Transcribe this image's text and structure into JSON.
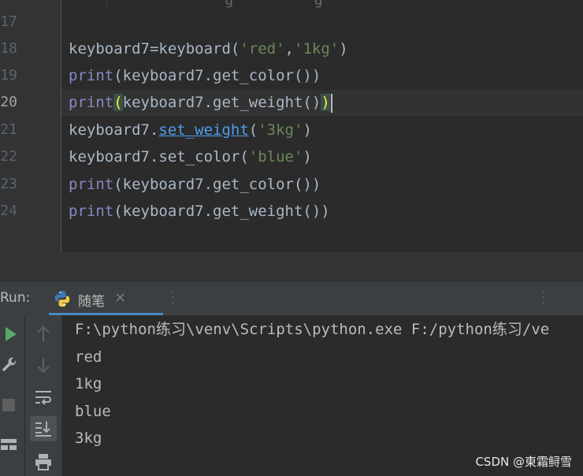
{
  "editor": {
    "top_cut_text": "    g         g      ",
    "line_numbers": [
      "17",
      "18",
      "19",
      "20",
      "21",
      "22",
      "23",
      "24"
    ],
    "current_line": "20",
    "lines": [
      {
        "num": "18",
        "tokens": [
          "keyboard7=keyboard(",
          "'red'",
          ",",
          "'1kg'",
          ")"
        ]
      },
      {
        "num": "19",
        "tokens": [
          "print",
          "(keyboard7.get_color())"
        ]
      },
      {
        "num": "20",
        "tokens": [
          "print",
          "(",
          "keyboard7.get_weight()",
          ")"
        ]
      },
      {
        "num": "21",
        "tokens": [
          "keyboard7.",
          "set_weight",
          "(",
          "'3kg'",
          ")"
        ]
      },
      {
        "num": "22",
        "tokens": [
          "keyboard7.set_color(",
          "'blue'",
          ")"
        ]
      },
      {
        "num": "23",
        "tokens": [
          "print",
          "(keyboard7.get_color())"
        ]
      },
      {
        "num": "24",
        "tokens": [
          "print",
          "(keyboard7.get_weight())"
        ]
      }
    ]
  },
  "run_panel": {
    "label": "Run:",
    "tab": {
      "label": "随笔",
      "close": "×",
      "icon": "python-icon"
    },
    "output": [
      "F:\\python练习\\venv\\Scripts\\python.exe F:/python练习/ve",
      "red",
      "1kg",
      "blue",
      "3kg"
    ]
  },
  "toolbar_icons": [
    "run-icon",
    "wrench-icon",
    "stop-icon",
    "layout-icon",
    "up-arrow-icon",
    "down-arrow-icon",
    "soft-wrap-icon",
    "scroll-to-end-icon",
    "print-icon"
  ],
  "colors": {
    "background": "#2b2b2b",
    "keyword": "#8888c6",
    "string": "#6a8759",
    "identifier": "#a9b7c6",
    "link": "#4f9dee",
    "brace_match": "#ffef28",
    "run_green": "#59a869"
  },
  "watermark": "CSDN @東霜鲟雪"
}
